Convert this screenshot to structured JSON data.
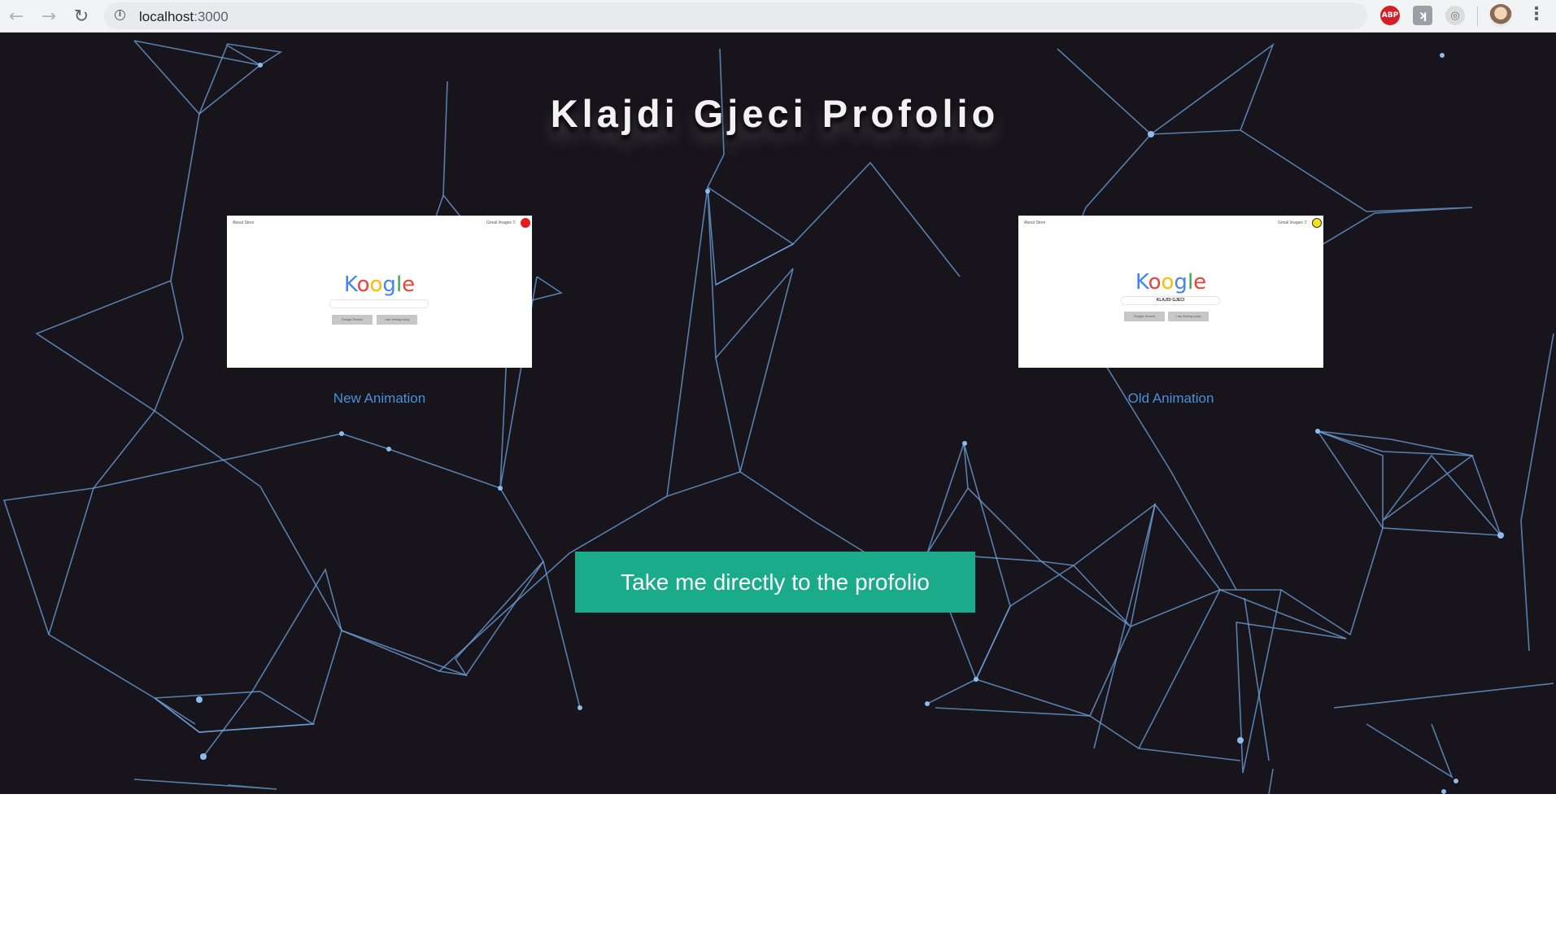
{
  "browser": {
    "url_host": "localhost",
    "url_port": ":3000",
    "back_icon": "arrow-left-icon",
    "forward_icon": "arrow-right-icon",
    "reload_icon": "reload-icon",
    "info_icon": "info-icon",
    "star_icon": "star-icon",
    "extensions": [
      {
        "name": "adblock-plus-icon",
        "label": "ABP"
      },
      {
        "name": "extension-icon",
        "label": "ʞ"
      },
      {
        "name": "extension-icon",
        "label": "◎"
      }
    ],
    "menu_icon": "more-vert-icon"
  },
  "page": {
    "title": "Klajdi Gjeci Profolio",
    "background_color": "#17141c",
    "network_color": "#6fa3dc",
    "cards": [
      {
        "label": "New Animation",
        "preview": {
          "nav_left": "About  Store",
          "nav_right": "Gmail   Images   ⠿",
          "logo": [
            "K",
            "o",
            "o",
            "g",
            "l",
            "e"
          ],
          "search_text": "",
          "buttons": [
            "Google Search",
            "I am feeling lucky"
          ],
          "dot_color": "#e61c1c"
        }
      },
      {
        "label": "Old Animation",
        "preview": {
          "nav_left": "About  Store",
          "nav_right": "Gmail   Images   ⠿",
          "logo": [
            "K",
            "o",
            "o",
            "g",
            "l",
            "e"
          ],
          "search_text": "KLAJDI GJECI",
          "buttons": [
            "Google Search",
            "I am feeling lucky"
          ],
          "dot_color": "#f5e21b"
        }
      }
    ],
    "cta_label": "Take me directly to the profolio",
    "cta_color": "#1aab8a"
  }
}
